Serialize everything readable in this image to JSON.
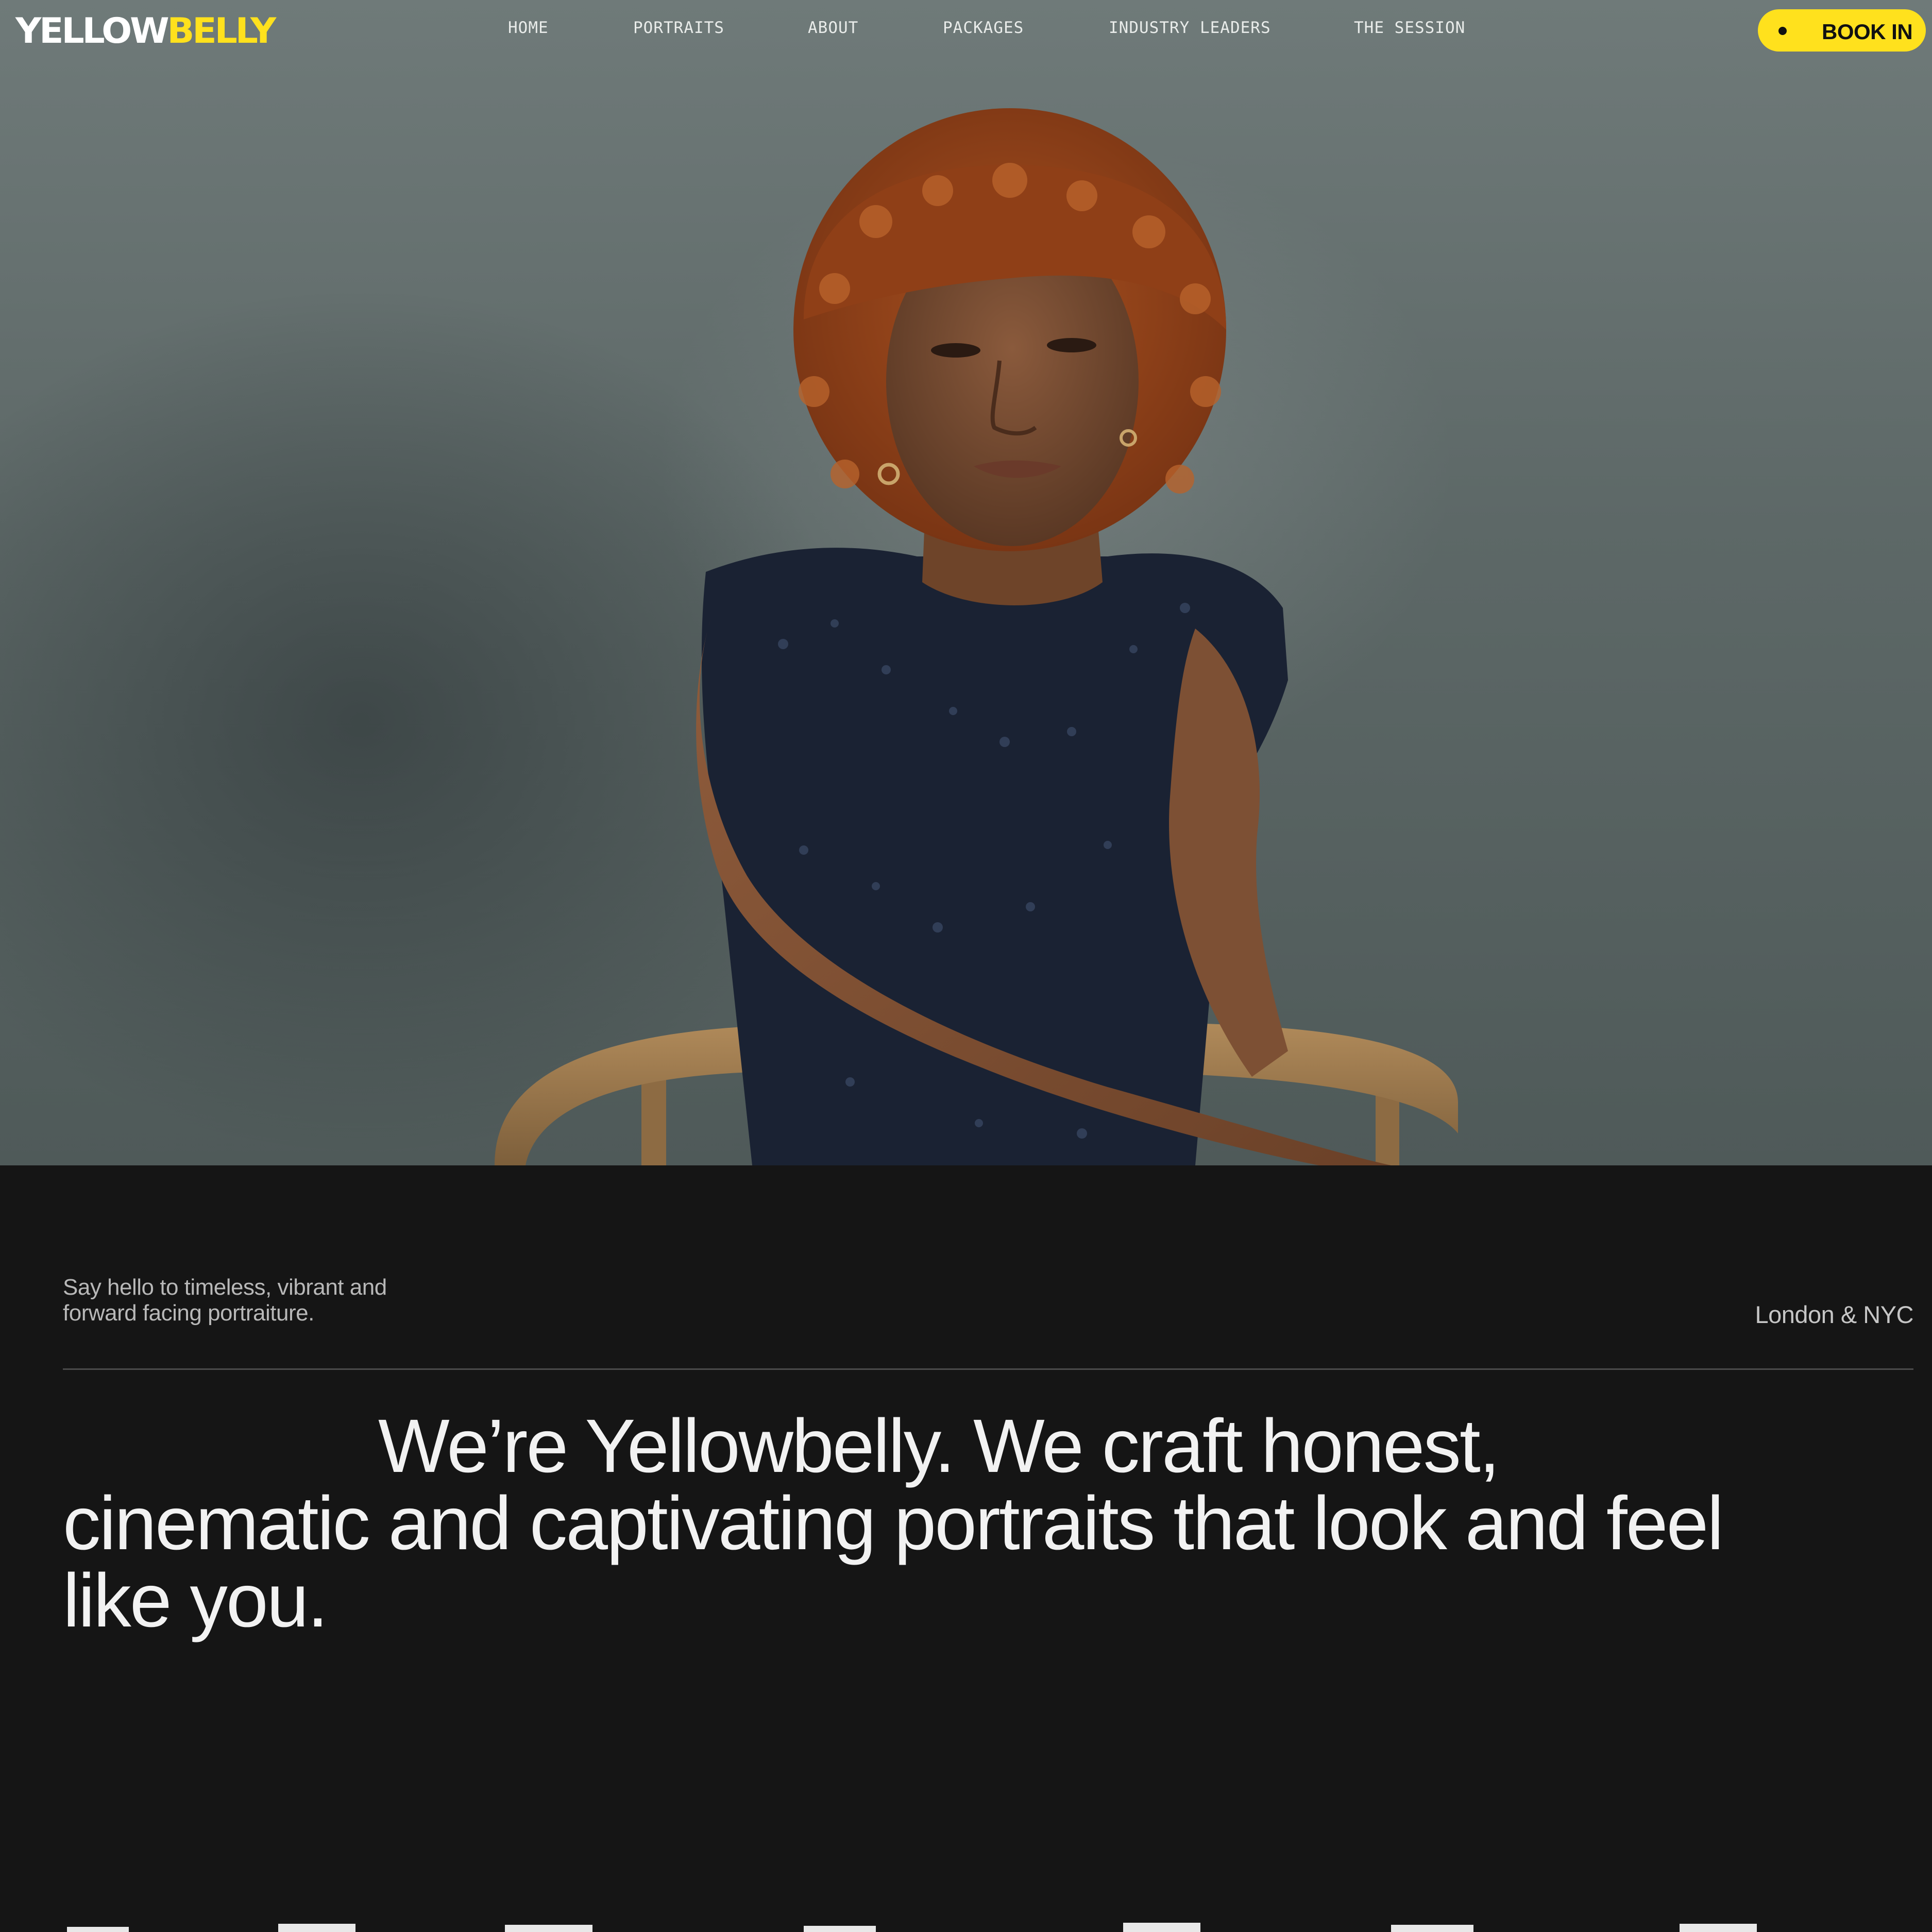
{
  "brand": {
    "logo_text_primary": "YELLOW",
    "logo_text_accent": "BELLY",
    "accent_color": "#ffe11d"
  },
  "nav": {
    "items": [
      {
        "label": "HOME"
      },
      {
        "label": "PORTRAITS"
      },
      {
        "label": "ABOUT"
      },
      {
        "label": "PACKAGES"
      },
      {
        "label": "INDUSTRY LEADERS"
      },
      {
        "label": "THE SESSION"
      }
    ],
    "cta_label": "BOOK IN"
  },
  "hero": {
    "image": "portrait-photo",
    "background_color": "#5d6867"
  },
  "intro": {
    "tagline_line1": "Say hello to timeless, vibrant and",
    "tagline_line2": "forward facing portraiture.",
    "location": "London & NYC",
    "statement": "We’re Yellowbelly. We craft honest, cinematic and captivating portraits that look and feel like you.",
    "background_color": "#151515"
  }
}
